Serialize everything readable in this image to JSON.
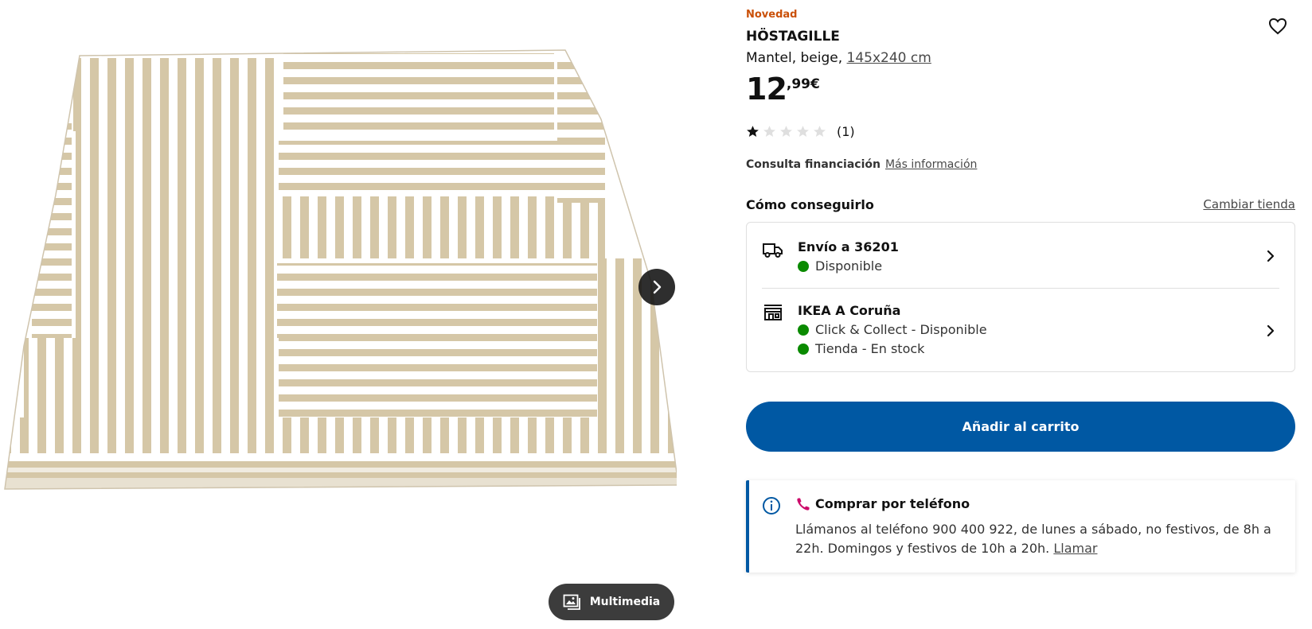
{
  "product": {
    "badge": "Novedad",
    "name": "HÖSTAGILLE",
    "description_prefix": "Mantel, beige, ",
    "size_link": "145x240 cm",
    "price_integer": "12",
    "price_decimal": ",99€",
    "rating": {
      "stars_filled": 1,
      "stars_total": 5,
      "count_label": "(1)"
    }
  },
  "financing": {
    "label": "Consulta financiación",
    "link": "Más información"
  },
  "availability": {
    "title": "Cómo conseguirlo",
    "change_store": "Cambiar tienda",
    "delivery": {
      "icon": "truck-icon",
      "title": "Envío a 36201",
      "status": "Disponible"
    },
    "store": {
      "icon": "store-icon",
      "title": "IKEA A Coruña",
      "status_collect": "Click & Collect - Disponible",
      "status_stock": "Tienda - En stock"
    },
    "status_color": "#0a8a00"
  },
  "cart": {
    "label": "Añadir al carrito",
    "color": "#0058a3"
  },
  "phone": {
    "title": "Comprar por teléfono",
    "text": "Llámanos al teléfono 900 400 922, de lunes a sábado, no festivos, de 8h a 22h. Domingos y festivos de 10h a 20h. ",
    "link": "Llamar"
  },
  "gallery": {
    "multimedia_label": "Multimedia",
    "image": "folded beige striped tablecloth"
  },
  "colors": {
    "badge": "#ca5008",
    "accent_blue": "#0058a3",
    "beige": "#d4c5a6"
  }
}
